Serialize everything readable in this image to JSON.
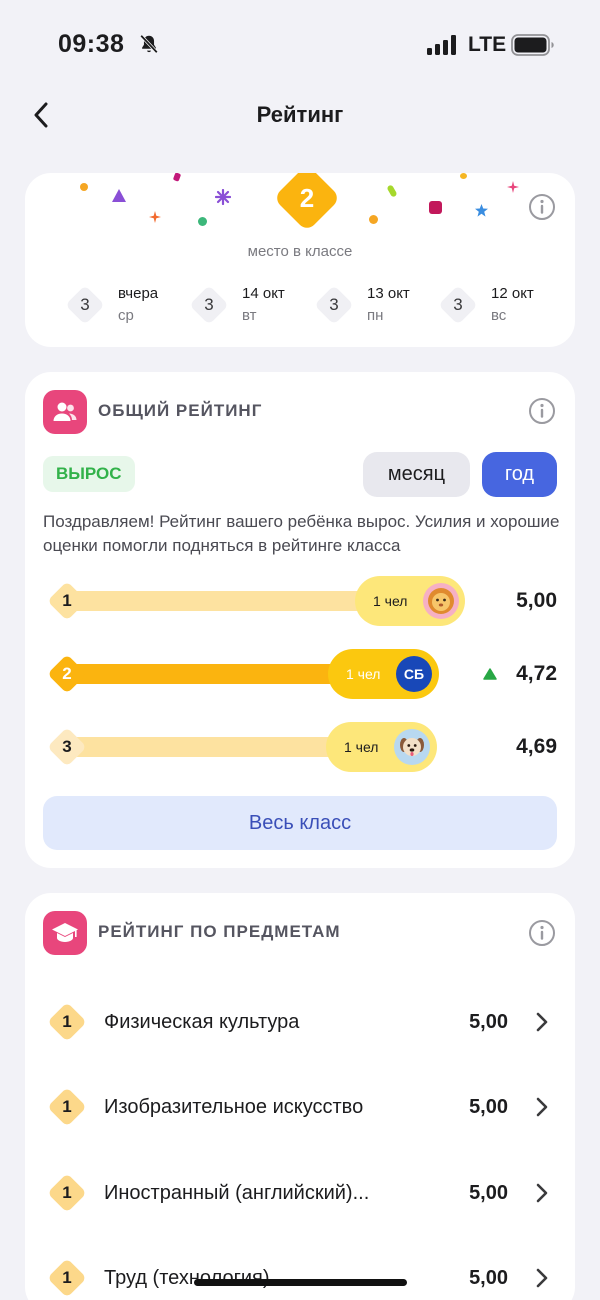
{
  "status_bar": {
    "time": "09:38",
    "network": "LTE"
  },
  "nav": {
    "title": "Рейтинг"
  },
  "place": {
    "value": "2",
    "caption": "место в классе",
    "history": [
      {
        "place": "3",
        "date": "вчера",
        "weekday": "ср"
      },
      {
        "place": "3",
        "date": "14 окт",
        "weekday": "вт"
      },
      {
        "place": "3",
        "date": "13 окт",
        "weekday": "пн"
      },
      {
        "place": "3",
        "date": "12 окт",
        "weekday": "вс"
      }
    ]
  },
  "general": {
    "title": "ОБЩИЙ РЕЙТИНГ",
    "badge": "ВЫРОС",
    "period_month": "месяц",
    "period_year": "год",
    "selected_period": "год",
    "description": "Поздравляем! Рейтинг вашего ребёнка вырос. Усилия и хорошие оценки помогли подняться в рейтинге класса",
    "ranks": [
      {
        "place": "1",
        "people": "1 чел",
        "avatar": "lion",
        "score": "5,00"
      },
      {
        "place": "2",
        "people": "1 чел",
        "avatar": "СБ",
        "score": "4,72",
        "trend": "up"
      },
      {
        "place": "3",
        "people": "1 чел",
        "avatar": "dog",
        "score": "4,69"
      }
    ],
    "whole_class_label": "Весь класс"
  },
  "subjects": {
    "title": "РЕЙТИНГ ПО ПРЕДМЕТАМ",
    "items": [
      {
        "place": "1",
        "name": "Физическая культура",
        "score": "5,00"
      },
      {
        "place": "1",
        "name": "Изобразительное искусство",
        "score": "5,00"
      },
      {
        "place": "1",
        "name": "Иностранный (английский)...",
        "score": "5,00"
      },
      {
        "place": "1",
        "name": "Труд (технология)",
        "score": "5,00"
      }
    ]
  },
  "colors": {
    "accent_blue": "#4766e0",
    "pink_icon": "#e8467c",
    "gold": "#fbb40f",
    "gold_light": "#fcd88a",
    "growth_green": "#32b24a"
  }
}
